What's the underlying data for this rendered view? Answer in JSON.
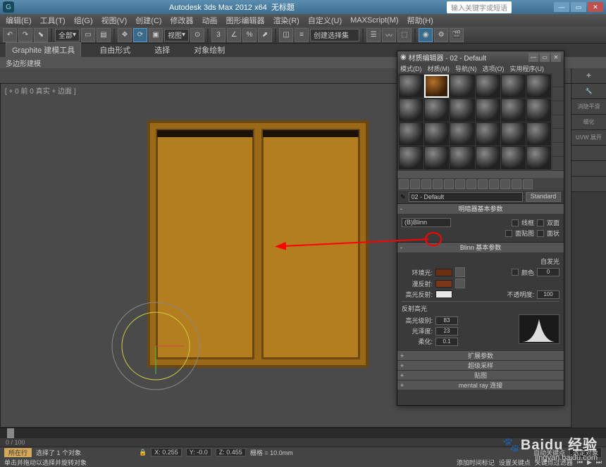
{
  "title_bar": {
    "app": "Autodesk 3ds Max 2012 x64",
    "doc": "无标题",
    "help_placeholder": "输入关键字或短语"
  },
  "menus": [
    "编辑(E)",
    "工具(T)",
    "组(G)",
    "视图(V)",
    "创建(C)",
    "修改器",
    "动画",
    "图形编辑器",
    "渲染(R)",
    "自定义(U)",
    "MAXScript(M)",
    "帮助(H)"
  ],
  "toolbar": {
    "dropdown1": "全部",
    "dropdown2": "视图",
    "dropdown3": "创建选择集"
  },
  "ribbon": {
    "tabs": [
      "Graphite 建模工具",
      "自由形式",
      "选择",
      "对象绘制"
    ],
    "sub": "多边形建模"
  },
  "viewport": {
    "label": "[ + 0 前 0 真实 + 边面 ]"
  },
  "mat_editor": {
    "title": "材质编辑器 - 02 - Default",
    "menus": [
      "模式(D)",
      "材质(M)",
      "导航(N)",
      "选项(O)",
      "实用程序(U)"
    ],
    "name": "02 - Default",
    "type_btn": "Standard",
    "sect_shader": "明暗器基本参数",
    "shader": "(B)Blinn",
    "shader_opts": [
      "线框",
      "双面",
      "面贴图",
      "面状"
    ],
    "sect_blinn": "Blinn 基本参数",
    "selflum": "自发光",
    "selflum_color": "颜色",
    "selflum_val": "0",
    "ambient": "环境光:",
    "diffuse": "漫反射:",
    "specular": "高光反射:",
    "opacity": "不透明度:",
    "opacity_val": "100",
    "sect_spec": "反射高光",
    "spec_level": "高光级别:",
    "spec_level_val": "83",
    "gloss": "光泽度:",
    "gloss_val": "23",
    "soften": "柔化:",
    "soften_val": "0.1",
    "rollups": [
      "扩展参数",
      "超级采样",
      "贴图",
      "mental ray 连接"
    ]
  },
  "cmd_panel": {
    "items": [
      "消隐平滑",
      "细化",
      "UVW 展开"
    ]
  },
  "bottom": {
    "frame": "0 / 100",
    "selected": "选择了 1 个对象",
    "hint": "单击并拖动以选择并旋转对象",
    "x": "X: 0.255",
    "y": "Y: -0.0",
    "z": "Z: 0.455",
    "grid": "栅格 = 10.0mm",
    "autokey": "自动关键点",
    "selset": "选定对象",
    "setkey": "设置关键点",
    "keyfilter": "关键点过滤器",
    "tag": "所在行",
    "addtime": "添加时间标记"
  },
  "watermark": {
    "brand": "Baidu 经验",
    "url": "jingyan.baidu.com"
  }
}
